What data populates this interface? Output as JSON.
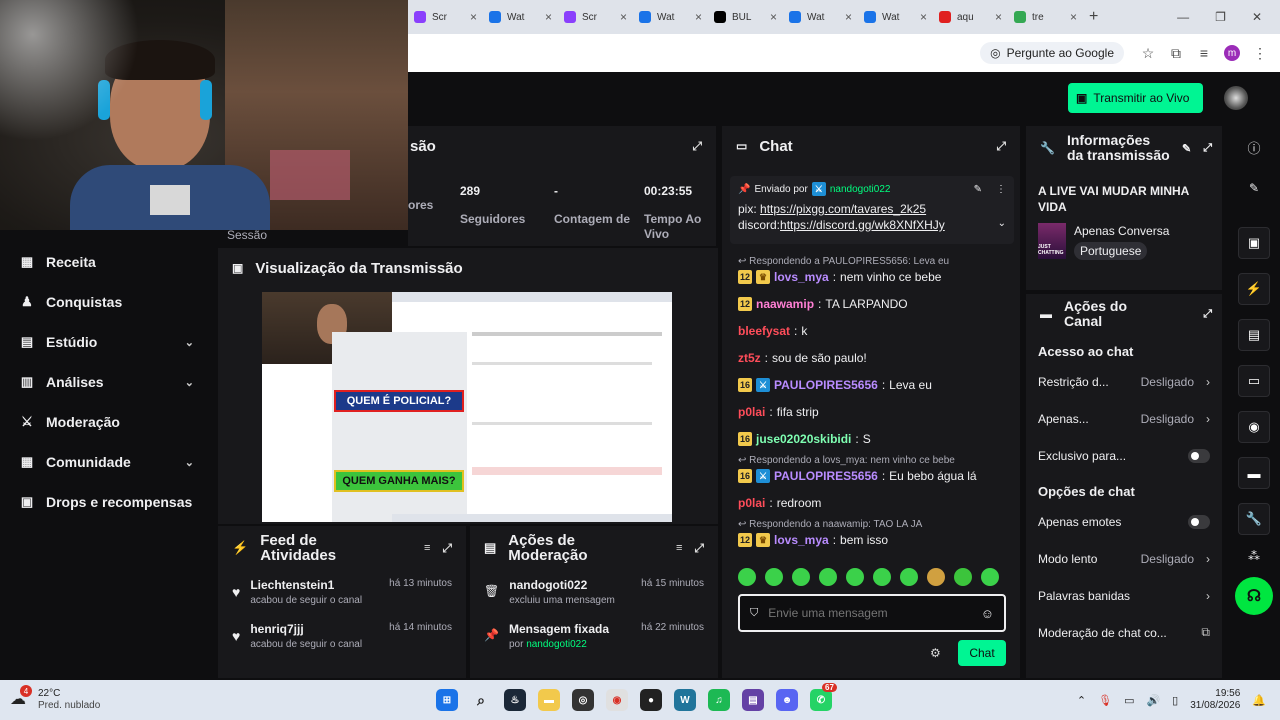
{
  "browser": {
    "tabs": [
      {
        "label": "Scr",
        "color": "#8a3ffc"
      },
      {
        "label": "Wat",
        "color": "#1a73e8"
      },
      {
        "label": "Scr",
        "color": "#8a3ffc"
      },
      {
        "label": "Wat",
        "color": "#1a73e8"
      },
      {
        "label": "BUL",
        "color": "#000000"
      },
      {
        "label": "Wat",
        "color": "#1a73e8"
      },
      {
        "label": "Wat",
        "color": "#1a73e8"
      },
      {
        "label": "aqu",
        "color": "#e02020"
      },
      {
        "label": "tre",
        "color": "#34a853"
      }
    ],
    "ask_google": "Pergunte ao Google",
    "profile_initial": "m"
  },
  "topbar": {
    "go_live_label": "Transmitir ao Vivo"
  },
  "leftnav": {
    "session_label": "Sessão",
    "items": [
      {
        "label": "Receita",
        "icon": "receipt-icon",
        "glyph": "▦",
        "chevron": false
      },
      {
        "label": "Conquistas",
        "icon": "trophy-icon",
        "glyph": "♟",
        "chevron": false
      },
      {
        "label": "Estúdio",
        "icon": "studio-icon",
        "glyph": "▤",
        "chevron": true
      },
      {
        "label": "Análises",
        "icon": "analytics-icon",
        "glyph": "▥",
        "chevron": true
      },
      {
        "label": "Moderação",
        "icon": "sword-icon",
        "glyph": "⚔",
        "chevron": false
      },
      {
        "label": "Comunidade",
        "icon": "community-icon",
        "glyph": "▦",
        "chevron": true
      },
      {
        "label": "Drops e recompensas",
        "icon": "gift-icon",
        "glyph": "▣",
        "chevron": false
      }
    ]
  },
  "session": {
    "title": "são",
    "stats": [
      {
        "value": "",
        "label": "ores"
      },
      {
        "value": "289",
        "label": "Seguidores"
      },
      {
        "value": "-",
        "label": "Contagem de"
      },
      {
        "value": "00:23:55",
        "label": "Tempo Ao Vivo"
      }
    ]
  },
  "preview": {
    "title": "Visualização da Transmissão",
    "thumb_text_1": "QUEM É POLICIAL?",
    "thumb_text_2": "QUEM GANHA MAIS?"
  },
  "activity": {
    "title": "Feed de Atividades",
    "items": [
      {
        "user": "Liechtenstein1",
        "action": "acabou de seguir o canal",
        "time": "há 13 minutos"
      },
      {
        "user": "henriq7jjj",
        "action": "acabou de seguir o canal",
        "time": "há 14 minutos"
      }
    ]
  },
  "modactions": {
    "title": "Ações de Moderação",
    "items": [
      {
        "user": "nandogoti022",
        "action": "excluiu uma mensagem",
        "by": "",
        "time": "há 15 minutos"
      },
      {
        "user": "Mensagem fixada",
        "action": "por",
        "by": "nandogoti022",
        "time": "há 22 minutos"
      }
    ]
  },
  "chat": {
    "title": "Chat",
    "pinned": {
      "sent_by": "Enviado por",
      "user": "nandogoti022",
      "line1_prefix": "pix: ",
      "line1_link": "https://pixgg.com/tavares_2k25",
      "line2_prefix": "discord: ",
      "line2_link": "https://discord.gg/wk8XNfXHJy"
    },
    "messages": [
      {
        "reply": "Respondendo a PAULOPIRES5656: Leva eu",
        "badges": [
          "12",
          "crown"
        ],
        "user": "lovs_mya",
        "color": "#b98cff",
        "text": "nem vinho ce bebe"
      },
      {
        "reply": "",
        "badges": [
          "12"
        ],
        "user": "naawamip",
        "color": "#ff7fd4",
        "text": "TA LARPANDO"
      },
      {
        "reply": "",
        "badges": [],
        "user": "bleefysat",
        "color": "#ff4d5a",
        "text": "k"
      },
      {
        "reply": "",
        "badges": [],
        "user": "zt5z",
        "color": "#ff4d5a",
        "text": "sou de são paulo!"
      },
      {
        "reply": "",
        "badges": [
          "16",
          "sword"
        ],
        "user": "PAULOPIRES5656",
        "color": "#b98cff",
        "text": "Leva eu"
      },
      {
        "reply": "",
        "badges": [],
        "user": "p0lai",
        "color": "#ff4d5a",
        "text": "fifa strip"
      },
      {
        "reply": "",
        "badges": [
          "16"
        ],
        "user": "juse02020skibidi",
        "color": "#7fffb2",
        "text": "S"
      },
      {
        "reply": "Respondendo a lovs_mya: nem vinho ce bebe",
        "badges": [
          "16",
          "sword"
        ],
        "user": "PAULOPIRES5656",
        "color": "#b98cff",
        "text": "Eu bebo água lá"
      },
      {
        "reply": "",
        "badges": [],
        "user": "p0lai",
        "color": "#ff4d5a",
        "text": "redroom"
      },
      {
        "reply": "Respondendo a naawamip: TAO LA JA",
        "badges": [
          "12",
          "crown"
        ],
        "user": "lovs_mya",
        "color": "#b98cff",
        "text": "bem isso"
      }
    ],
    "input_placeholder": "Envie uma mensagem",
    "send_label": "Chat"
  },
  "info": {
    "title": "Informações da transmissão",
    "stream_title": "A LIVE VAI MUDAR MINHA VIDA",
    "category": "Apenas Conversa",
    "language": "Portuguese",
    "thumb_caption": "JUST CHATTING"
  },
  "channel_actions": {
    "title": "Ações do Canal",
    "section1": "Acesso ao chat",
    "rows1": [
      {
        "label": "Restrição d...",
        "value": "Desligado",
        "type": "arrow"
      },
      {
        "label": "Apenas...",
        "value": "Desligado",
        "type": "arrow"
      },
      {
        "label": "Exclusivo para...",
        "value": "",
        "type": "toggle"
      }
    ],
    "section2": "Opções de chat",
    "rows2": [
      {
        "label": "Apenas emotes",
        "value": "",
        "type": "toggle"
      },
      {
        "label": "Modo lento",
        "value": "Desligado",
        "type": "arrow"
      },
      {
        "label": "Palavras banidas",
        "value": "",
        "type": "arrow"
      },
      {
        "label": "Moderação de chat co...",
        "value": "",
        "type": "external"
      }
    ]
  },
  "taskbar": {
    "weather_temp": "22°C",
    "weather_desc": "Pred. nublado",
    "weather_badge": "4",
    "time": "19:56",
    "date": "31/08/2026",
    "whatsapp_badge": "67"
  }
}
